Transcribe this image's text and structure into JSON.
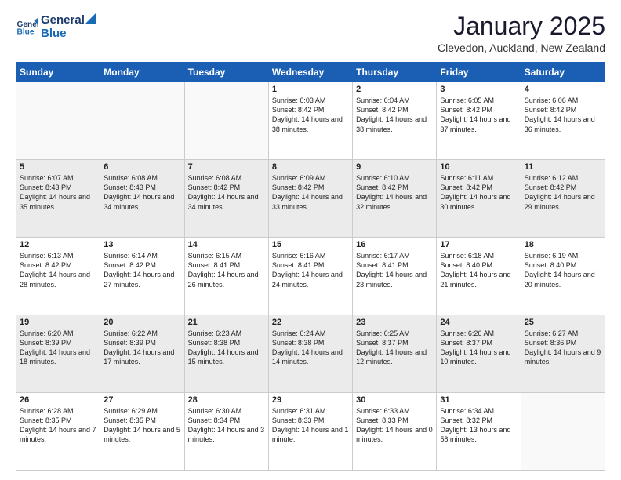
{
  "header": {
    "logo_text_general": "General",
    "logo_text_blue": "Blue",
    "month_title": "January 2025",
    "location": "Clevedon, Auckland, New Zealand"
  },
  "days_of_week": [
    "Sunday",
    "Monday",
    "Tuesday",
    "Wednesday",
    "Thursday",
    "Friday",
    "Saturday"
  ],
  "weeks": [
    {
      "shaded": false,
      "days": [
        {
          "number": "",
          "sunrise": "",
          "sunset": "",
          "daylight": "",
          "empty": true
        },
        {
          "number": "",
          "sunrise": "",
          "sunset": "",
          "daylight": "",
          "empty": true
        },
        {
          "number": "",
          "sunrise": "",
          "sunset": "",
          "daylight": "",
          "empty": true
        },
        {
          "number": "1",
          "sunrise": "Sunrise: 6:03 AM",
          "sunset": "Sunset: 8:42 PM",
          "daylight": "Daylight: 14 hours and 38 minutes.",
          "empty": false
        },
        {
          "number": "2",
          "sunrise": "Sunrise: 6:04 AM",
          "sunset": "Sunset: 8:42 PM",
          "daylight": "Daylight: 14 hours and 38 minutes.",
          "empty": false
        },
        {
          "number": "3",
          "sunrise": "Sunrise: 6:05 AM",
          "sunset": "Sunset: 8:42 PM",
          "daylight": "Daylight: 14 hours and 37 minutes.",
          "empty": false
        },
        {
          "number": "4",
          "sunrise": "Sunrise: 6:06 AM",
          "sunset": "Sunset: 8:42 PM",
          "daylight": "Daylight: 14 hours and 36 minutes.",
          "empty": false
        }
      ]
    },
    {
      "shaded": true,
      "days": [
        {
          "number": "5",
          "sunrise": "Sunrise: 6:07 AM",
          "sunset": "Sunset: 8:43 PM",
          "daylight": "Daylight: 14 hours and 35 minutes.",
          "empty": false
        },
        {
          "number": "6",
          "sunrise": "Sunrise: 6:08 AM",
          "sunset": "Sunset: 8:43 PM",
          "daylight": "Daylight: 14 hours and 34 minutes.",
          "empty": false
        },
        {
          "number": "7",
          "sunrise": "Sunrise: 6:08 AM",
          "sunset": "Sunset: 8:42 PM",
          "daylight": "Daylight: 14 hours and 34 minutes.",
          "empty": false
        },
        {
          "number": "8",
          "sunrise": "Sunrise: 6:09 AM",
          "sunset": "Sunset: 8:42 PM",
          "daylight": "Daylight: 14 hours and 33 minutes.",
          "empty": false
        },
        {
          "number": "9",
          "sunrise": "Sunrise: 6:10 AM",
          "sunset": "Sunset: 8:42 PM",
          "daylight": "Daylight: 14 hours and 32 minutes.",
          "empty": false
        },
        {
          "number": "10",
          "sunrise": "Sunrise: 6:11 AM",
          "sunset": "Sunset: 8:42 PM",
          "daylight": "Daylight: 14 hours and 30 minutes.",
          "empty": false
        },
        {
          "number": "11",
          "sunrise": "Sunrise: 6:12 AM",
          "sunset": "Sunset: 8:42 PM",
          "daylight": "Daylight: 14 hours and 29 minutes.",
          "empty": false
        }
      ]
    },
    {
      "shaded": false,
      "days": [
        {
          "number": "12",
          "sunrise": "Sunrise: 6:13 AM",
          "sunset": "Sunset: 8:42 PM",
          "daylight": "Daylight: 14 hours and 28 minutes.",
          "empty": false
        },
        {
          "number": "13",
          "sunrise": "Sunrise: 6:14 AM",
          "sunset": "Sunset: 8:42 PM",
          "daylight": "Daylight: 14 hours and 27 minutes.",
          "empty": false
        },
        {
          "number": "14",
          "sunrise": "Sunrise: 6:15 AM",
          "sunset": "Sunset: 8:41 PM",
          "daylight": "Daylight: 14 hours and 26 minutes.",
          "empty": false
        },
        {
          "number": "15",
          "sunrise": "Sunrise: 6:16 AM",
          "sunset": "Sunset: 8:41 PM",
          "daylight": "Daylight: 14 hours and 24 minutes.",
          "empty": false
        },
        {
          "number": "16",
          "sunrise": "Sunrise: 6:17 AM",
          "sunset": "Sunset: 8:41 PM",
          "daylight": "Daylight: 14 hours and 23 minutes.",
          "empty": false
        },
        {
          "number": "17",
          "sunrise": "Sunrise: 6:18 AM",
          "sunset": "Sunset: 8:40 PM",
          "daylight": "Daylight: 14 hours and 21 minutes.",
          "empty": false
        },
        {
          "number": "18",
          "sunrise": "Sunrise: 6:19 AM",
          "sunset": "Sunset: 8:40 PM",
          "daylight": "Daylight: 14 hours and 20 minutes.",
          "empty": false
        }
      ]
    },
    {
      "shaded": true,
      "days": [
        {
          "number": "19",
          "sunrise": "Sunrise: 6:20 AM",
          "sunset": "Sunset: 8:39 PM",
          "daylight": "Daylight: 14 hours and 18 minutes.",
          "empty": false
        },
        {
          "number": "20",
          "sunrise": "Sunrise: 6:22 AM",
          "sunset": "Sunset: 8:39 PM",
          "daylight": "Daylight: 14 hours and 17 minutes.",
          "empty": false
        },
        {
          "number": "21",
          "sunrise": "Sunrise: 6:23 AM",
          "sunset": "Sunset: 8:38 PM",
          "daylight": "Daylight: 14 hours and 15 minutes.",
          "empty": false
        },
        {
          "number": "22",
          "sunrise": "Sunrise: 6:24 AM",
          "sunset": "Sunset: 8:38 PM",
          "daylight": "Daylight: 14 hours and 14 minutes.",
          "empty": false
        },
        {
          "number": "23",
          "sunrise": "Sunrise: 6:25 AM",
          "sunset": "Sunset: 8:37 PM",
          "daylight": "Daylight: 14 hours and 12 minutes.",
          "empty": false
        },
        {
          "number": "24",
          "sunrise": "Sunrise: 6:26 AM",
          "sunset": "Sunset: 8:37 PM",
          "daylight": "Daylight: 14 hours and 10 minutes.",
          "empty": false
        },
        {
          "number": "25",
          "sunrise": "Sunrise: 6:27 AM",
          "sunset": "Sunset: 8:36 PM",
          "daylight": "Daylight: 14 hours and 9 minutes.",
          "empty": false
        }
      ]
    },
    {
      "shaded": false,
      "days": [
        {
          "number": "26",
          "sunrise": "Sunrise: 6:28 AM",
          "sunset": "Sunset: 8:35 PM",
          "daylight": "Daylight: 14 hours and 7 minutes.",
          "empty": false
        },
        {
          "number": "27",
          "sunrise": "Sunrise: 6:29 AM",
          "sunset": "Sunset: 8:35 PM",
          "daylight": "Daylight: 14 hours and 5 minutes.",
          "empty": false
        },
        {
          "number": "28",
          "sunrise": "Sunrise: 6:30 AM",
          "sunset": "Sunset: 8:34 PM",
          "daylight": "Daylight: 14 hours and 3 minutes.",
          "empty": false
        },
        {
          "number": "29",
          "sunrise": "Sunrise: 6:31 AM",
          "sunset": "Sunset: 8:33 PM",
          "daylight": "Daylight: 14 hours and 1 minute.",
          "empty": false
        },
        {
          "number": "30",
          "sunrise": "Sunrise: 6:33 AM",
          "sunset": "Sunset: 8:33 PM",
          "daylight": "Daylight: 14 hours and 0 minutes.",
          "empty": false
        },
        {
          "number": "31",
          "sunrise": "Sunrise: 6:34 AM",
          "sunset": "Sunset: 8:32 PM",
          "daylight": "Daylight: 13 hours and 58 minutes.",
          "empty": false
        },
        {
          "number": "",
          "sunrise": "",
          "sunset": "",
          "daylight": "",
          "empty": true
        }
      ]
    }
  ]
}
